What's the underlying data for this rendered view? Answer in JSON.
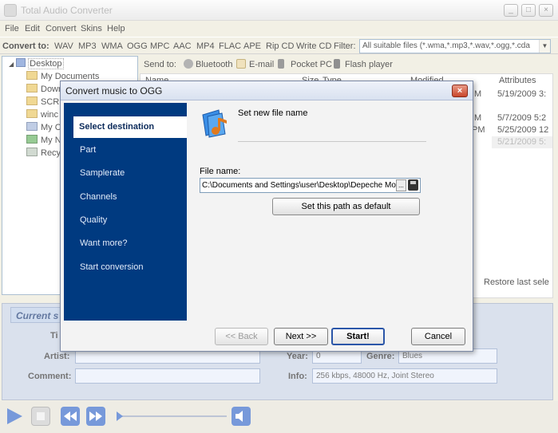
{
  "app": {
    "title": "Total Audio Converter",
    "window_buttons": [
      "_",
      "□",
      "×"
    ]
  },
  "menu": [
    "File",
    "Edit",
    "Convert",
    "Skins",
    "Help"
  ],
  "convert_bar": {
    "label": "Convert to:",
    "formats": [
      "WAV",
      "MP3",
      "WMA",
      "OGG",
      "MPC",
      "AAC",
      "MP4",
      "FLAC",
      "APE",
      "Rip CD",
      "Write CD"
    ],
    "filter_label": "Filter:",
    "filter_value": "All suitable files (*.wma,*.mp3,*.wav,*.ogg,*.cda"
  },
  "tree": {
    "root": "Desktop",
    "items": [
      "My Documents",
      "Dowr",
      "SCRE",
      "winc",
      "My C",
      "My N",
      "Recy"
    ]
  },
  "send_to": {
    "label": "Send to:",
    "targets": [
      "Bluetooth",
      "E-mail",
      "Pocket PC",
      "Flash player"
    ]
  },
  "file_list": {
    "columns": [
      "Name",
      "Size",
      "Type",
      "Modified",
      "Attributes"
    ],
    "rows": [
      {
        "modified_part": "M",
        "attr": "5/19/2009 3:"
      },
      {
        "modified_part": "M",
        "attr": "5/7/2009 5:2"
      },
      {
        "modified_part": "PM",
        "attr": "5/25/2009 12"
      },
      {
        "modified_part": "",
        "attr": "5/21/2009 5:"
      }
    ],
    "restore_label": "Restore last sele"
  },
  "current_info": {
    "header": "Current s",
    "labels": {
      "title": "Ti",
      "artist": "Artist:",
      "comment": "Comment:",
      "year": "Year:",
      "genre": "Genre:",
      "info": "Info:"
    },
    "values": {
      "year": "0",
      "genre": "Blues",
      "info": "256 kbps, 48000 Hz, Joint Stereo"
    }
  },
  "dialog": {
    "title": "Convert music to OGG",
    "close": "×",
    "steps": [
      "Select destination",
      "Part",
      "Samplerate",
      "Channels",
      "Quality",
      "Want more?",
      "Start conversion"
    ],
    "active_step": "Select destination",
    "section_title": "Set new file name",
    "file_name_label": "File name:",
    "file_name_value": "C:\\Documents and Settings\\user\\Desktop\\Depeche Mo",
    "browse": "...",
    "set_default": "Set this path as default",
    "buttons": {
      "back": "<< Back",
      "next": "Next >>",
      "start": "Start!",
      "cancel": "Cancel"
    }
  },
  "colors": {
    "sidebar": "#003a80",
    "accent": "#2b56a8"
  }
}
